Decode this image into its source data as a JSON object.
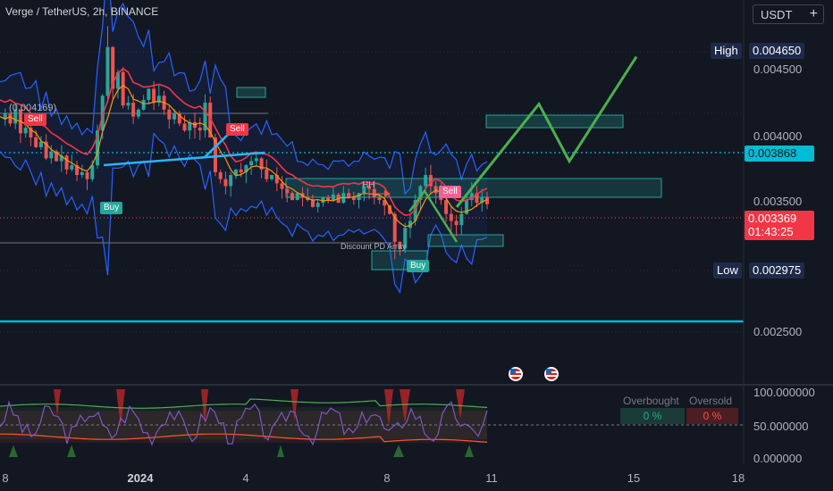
{
  "header": {
    "title": "Verge / TetherUS, 2h, BINANCE",
    "currency": "USDT",
    "add_symbol": "+"
  },
  "price_axis": {
    "high_label": "High",
    "high_value": "0.004650",
    "low_label": "Low",
    "low_value": "0.002975",
    "current_price": "0.003369",
    "countdown": "01:43:25",
    "marked_level": "0.003868",
    "ticks": [
      "0.004500",
      "0.004000",
      "0.003500",
      "0.002500"
    ]
  },
  "time_axis": {
    "ticks": [
      "8",
      "2024",
      "4",
      "8",
      "11",
      "15",
      "18"
    ]
  },
  "indicator_axis": {
    "ticks": [
      "100.000000",
      "50.000000",
      "0.000000"
    ]
  },
  "annotations": {
    "prior_high": "(0.004169)",
    "hh": "HH",
    "discount": "Discount PD Array"
  },
  "signals": {
    "sell": "Sell",
    "buy": "Buy"
  },
  "overbought_oversold": {
    "overbought_label": "Overbought",
    "oversold_label": "Oversold",
    "overbought_value": "0 %",
    "oversold_value": "0 %"
  },
  "colors": {
    "background": "#131722",
    "bull": "#26a69a",
    "bear": "#ef5350",
    "projection": "#4caf50",
    "level_line": "#00bcd4",
    "band": "#2962ff",
    "axis_tag": "#1e2a4a"
  },
  "chart_data": {
    "type": "line",
    "x_axis": "time",
    "y_range": [
      0.0022,
      0.0048
    ],
    "horizontal_levels": [
      0.003868,
      0.00262
    ],
    "high": 0.00465,
    "low": 0.002975,
    "last": 0.003369,
    "price_series": [
      0.00398,
      0.00402,
      0.00395,
      0.00405,
      0.00388,
      0.00392,
      0.00385,
      0.00378,
      0.00382,
      0.0037,
      0.00375,
      0.00368,
      0.00372,
      0.00362,
      0.00365,
      0.00358,
      0.0036,
      0.00355,
      0.00365,
      0.0039,
      0.00415,
      0.0045,
      0.0042,
      0.00432,
      0.00408,
      0.0041,
      0.004,
      0.00405,
      0.00412,
      0.0042,
      0.0041,
      0.00415,
      0.00405,
      0.00398,
      0.00402,
      0.00395,
      0.0039,
      0.00396,
      0.00392,
      0.0039,
      0.0041,
      0.00385,
      0.0036,
      0.00355,
      0.0035,
      0.00358,
      0.00362,
      0.0036,
      0.00365,
      0.00368,
      0.0037,
      0.00362,
      0.00355,
      0.00358,
      0.00352,
      0.00348,
      0.00345,
      0.0034,
      0.00345,
      0.00342,
      0.0034,
      0.00335,
      0.00338,
      0.00342,
      0.0034,
      0.00344,
      0.00338,
      0.00345,
      0.00342,
      0.0034,
      0.00345,
      0.0035,
      0.00348,
      0.00342,
      0.0034,
      0.00336,
      0.0033,
      0.0031,
      0.00305,
      0.0032,
      0.00325,
      0.0034,
      0.0035,
      0.00358,
      0.0035,
      0.00345,
      0.0034,
      0.0033,
      0.00325,
      0.00322,
      0.0033,
      0.0034,
      0.00345,
      0.00338,
      0.00342,
      0.00337
    ],
    "projection_path": [
      0.00335,
      0.00409,
      0.00368,
      0.00443
    ]
  }
}
